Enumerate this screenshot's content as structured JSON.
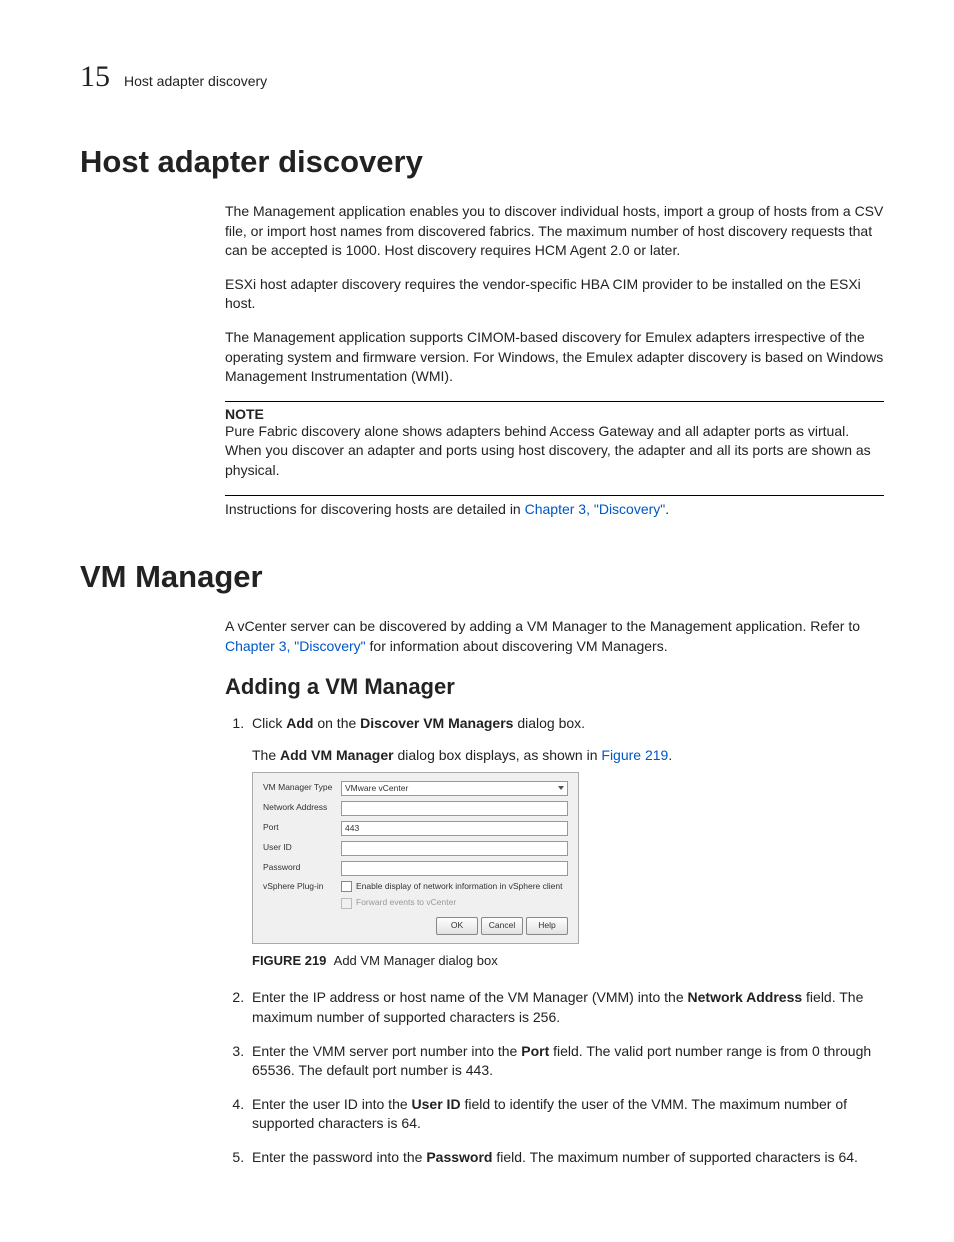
{
  "header": {
    "chapter_number": "15",
    "chapter_title": "Host adapter discovery"
  },
  "section1": {
    "title": "Host adapter discovery",
    "p1": "The Management application enables you to discover individual hosts, import a group of hosts from a CSV file, or import host names from discovered fabrics. The maximum number of host discovery requests that can be accepted is 1000. Host discovery requires HCM Agent 2.0 or later.",
    "p2": "ESXi host adapter discovery requires the vendor-specific HBA CIM provider to be installed on the ESXi host.",
    "p3": "The Management application supports CIMOM-based discovery for Emulex adapters irrespective of the operating system and firmware version. For Windows, the Emulex adapter discovery is based on Windows Management Instrumentation (WMI).",
    "note_label": "NOTE",
    "note_body": "Pure Fabric discovery alone shows adapters behind Access Gateway and all adapter ports as virtual. When you discover an adapter and ports using host discovery, the adapter and all its ports are shown as physical.",
    "p4_pre": "Instructions for discovering hosts are detailed in ",
    "p4_link": "Chapter 3, \"Discovery\"",
    "p4_post": "."
  },
  "section2": {
    "title": "VM Manager",
    "intro_pre": "A vCenter server can be discovered by adding a VM Manager to the Management application. Refer to ",
    "intro_link": "Chapter 3, \"Discovery\"",
    "intro_post": " for information about discovering VM Managers.",
    "sub_title": "Adding a VM Manager",
    "step1_a": "Click ",
    "step1_b": "Add",
    "step1_c": " on the ",
    "step1_d": "Discover VM Managers",
    "step1_e": " dialog box.",
    "step1_sub_a": "The ",
    "step1_sub_b": "Add VM Manager",
    "step1_sub_c": " dialog box displays, as shown in ",
    "step1_sub_link": "Figure 219",
    "step1_sub_d": ".",
    "fig_label": "FIGURE 219",
    "fig_caption": "Add VM Manager dialog box",
    "step2_a": "Enter the IP address or host name of the VM Manager (VMM) into the ",
    "step2_b": "Network Address",
    "step2_c": " field. The maximum number of supported characters is 256.",
    "step3_a": "Enter the VMM server port number into the ",
    "step3_b": "Port",
    "step3_c": " field. The valid port number range is from 0 through 65536. The default port number is 443.",
    "step4_a": "Enter the user ID into the ",
    "step4_b": "User ID",
    "step4_c": " field to identify the user of the VMM. The maximum number of supported characters is 64.",
    "step5_a": "Enter the password into the ",
    "step5_b": "Password",
    "step5_c": " field. The maximum number of supported characters is 64."
  },
  "dialog": {
    "labels": {
      "type": "VM Manager Type",
      "addr": "Network Address",
      "port": "Port",
      "user": "User ID",
      "pass": "Password",
      "plugin": "vSphere Plug-in"
    },
    "values": {
      "type": "VMware vCenter",
      "port": "443",
      "chk1": "Enable display of network information in vSphere client",
      "chk2": "Forward events to vCenter"
    },
    "buttons": {
      "ok": "OK",
      "cancel": "Cancel",
      "help": "Help"
    }
  }
}
